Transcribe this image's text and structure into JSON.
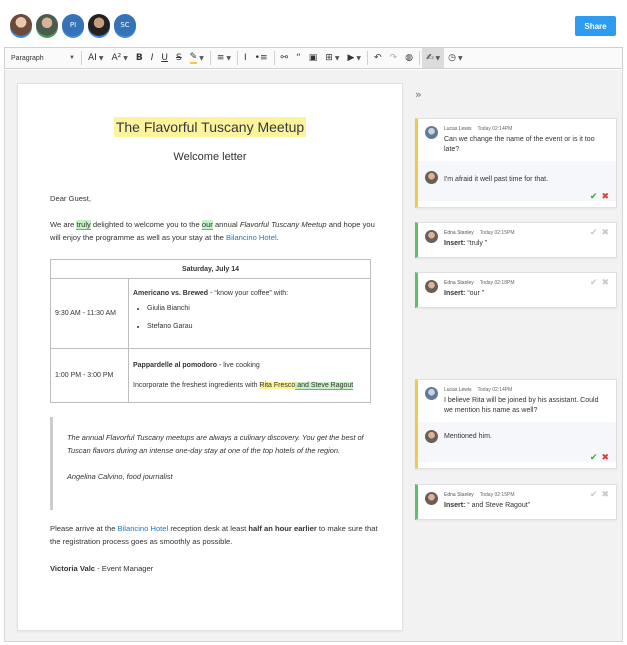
{
  "header": {
    "share_label": "Share",
    "collaborators": [
      {
        "initials": "",
        "ring": "#3d8bd9"
      },
      {
        "initials": "",
        "ring": "#3da142"
      },
      {
        "initials": "PI",
        "ring": "#3d8bd9"
      },
      {
        "initials": "",
        "ring": "#3d8bd9"
      },
      {
        "initials": "SC",
        "ring": "#3d8bd9"
      }
    ]
  },
  "toolbar": {
    "paragraph": "Paragraph",
    "font_size": "AI",
    "font_family": "A²",
    "bold": "B",
    "italic": "I",
    "underline": "U",
    "strike": "S",
    "highlight": "✎",
    "align": "≡",
    "numbered_list": "Ⅰ",
    "bullet_list": "•≡",
    "link": "⚯",
    "quote": "“",
    "image": "▣",
    "table": "⊞",
    "media": "▶",
    "undo": "↶",
    "redo": "↷",
    "comment": "◍",
    "track_changes": "✍",
    "history": "◷"
  },
  "document": {
    "title": "The Flavorful Tuscany Meetup",
    "subtitle": "Welcome letter",
    "greeting": "Dear Guest,",
    "intro": {
      "p1": "We are ",
      "truly": "truly",
      "p2": " delighted to welcome you to the ",
      "our": "our",
      "p3": " annual ",
      "event_name": "Flavorful Tuscany Meetup",
      "p4": " and hope you will enjoy the programme as well as your stay at the ",
      "hotel": "Bilancino Hotel",
      "p5": "."
    },
    "schedule": {
      "date": "Saturday, July 14",
      "rows": [
        {
          "time": "9:30 AM - 11:30 AM",
          "title": "Americano vs. Brewed",
          "desc": " - “know your coffee” with:",
          "people": [
            "Giulia Bianchi",
            "Stefano Garau"
          ]
        },
        {
          "time": "1:00 PM - 3:00 PM",
          "title": "Pappardelle al pomodoro",
          "desc": " - live cooking",
          "line2": "Incorporate the freshest ingredients with ",
          "rita": "Rita Fresco",
          "steve": " and Steve Ragout"
        }
      ]
    },
    "quote": {
      "text": "The annual Flavorful Tuscany meetups are always a culinary discovery. You get the best of Tuscan flavors during an intense one-day stay at one of the top hotels of the region.",
      "author": "Angelina Calvino, food journalist"
    },
    "closing": {
      "p1": "Please arrive at the ",
      "hotel": "Bilancino Hotel",
      "p2": " reception desk at least ",
      "bold": "half an hour earlier",
      "p3": " to make sure that the registration process goes as smoothly as possible."
    },
    "signature": {
      "name": "Victoria Valc",
      "role": " - Event Manager"
    }
  },
  "sidebar": {
    "toggle": "»",
    "threads": [
      {
        "bar": "#f2c94c",
        "messages": [
          {
            "author": "Lucas Lewis",
            "time": "Today 02:14PM",
            "text": "Can we change the name of the event or is it too late?",
            "avatar": "lucas"
          },
          {
            "author": "",
            "time": "",
            "text": "I'm afraid it well past time for that.",
            "avatar": "edna"
          }
        ],
        "actions": true
      },
      {
        "bar": "#5cc16a",
        "messages": [
          {
            "author": "Edna Stanley",
            "time": "Today 02:15PM",
            "label": "Insert:",
            "text": " “truly ”",
            "avatar": "edna"
          }
        ],
        "actions": "dim"
      },
      {
        "bar": "#5cc16a",
        "messages": [
          {
            "author": "Edna Stanley",
            "time": "Today 02:18PM",
            "label": "Insert:",
            "text": " “our ”",
            "avatar": "edna"
          }
        ],
        "actions": "dim"
      },
      {
        "bar": "#f2c94c",
        "messages": [
          {
            "author": "Lucas Lewis",
            "time": "Today 02:14PM",
            "text": "I believe Rita will be joined by his assistant. Could we mention his name as well?",
            "avatar": "lucas"
          },
          {
            "author": "",
            "time": "",
            "text": "Mentioned him.",
            "avatar": "edna"
          }
        ],
        "actions": true
      },
      {
        "bar": "#5cc16a",
        "messages": [
          {
            "author": "Edna Stanley",
            "time": "Today 02:15PM",
            "label": "Insert:",
            "text": " “ and Steve Ragout”",
            "avatar": "edna"
          }
        ],
        "actions": "dim"
      }
    ],
    "check": "✔",
    "cross": "✖"
  }
}
